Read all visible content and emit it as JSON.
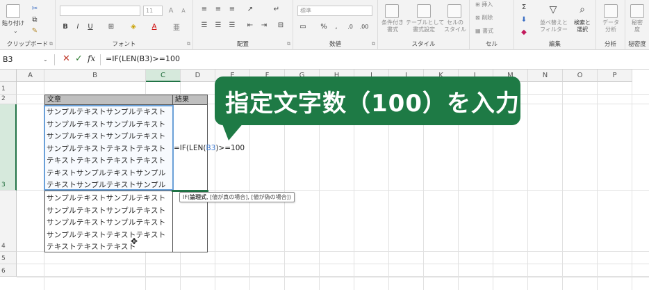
{
  "ribbon": {
    "clipboard": {
      "paste_label": "貼り付け",
      "group_label": "クリップボード"
    },
    "font": {
      "font_size": "11",
      "group_label": "フォント"
    },
    "alignment": {
      "group_label": "配置"
    },
    "number": {
      "format": "標準",
      "group_label": "数値"
    },
    "styles": {
      "conditional_label": "条件付き\n書式",
      "table_label": "テーブルとして\n書式設定",
      "cell_style_label": "セルの\nスタイル",
      "group_label": "スタイル"
    },
    "cells": {
      "insert_label": "挿入",
      "delete_label": "削除",
      "format_label": "書式",
      "group_label": "セル"
    },
    "editing": {
      "sort_label": "並べ替えと\nフィルター",
      "find_label": "検索と\n選択",
      "group_label": "編集"
    },
    "analysis": {
      "data_analysis_label": "データ\n分析",
      "group_label": "分析"
    },
    "sensitivity": {
      "label": "秘密\n度",
      "group_label": "秘密度"
    }
  },
  "formula_bar": {
    "name_box": "B3",
    "fx": "fx",
    "formula": "=IF(LEN(B3)>=100"
  },
  "columns": [
    "A",
    "B",
    "C",
    "D",
    "E",
    "F",
    "G",
    "H",
    "I",
    "J",
    "K",
    "L",
    "M",
    "N",
    "O",
    "P"
  ],
  "selected_column": "C",
  "rows": [
    "1",
    "2",
    "3",
    "4",
    "5",
    "6"
  ],
  "selected_row": "3",
  "table": {
    "header_text": "文章",
    "header_result": "結果",
    "b3_lines": [
      "サンプルテキストサンプルテキスト",
      "サンプルテキストサンプルテキスト",
      "サンプルテキストサンプルテキスト",
      "サンプルテキストテキストテキスト",
      "テキストテキストテキストテキスト",
      "テキストサンプルテキストサンプル",
      "テキストサンプルテキストサンプル"
    ],
    "b4_lines": [
      "サンプルテキストサンプルテキスト",
      "サンプルテキストサンプルテキスト",
      "サンプルテキストサンプルテキスト",
      "サンプルテキストテキストテキスト",
      "テキストテキストテキスト"
    ],
    "c3_prefix": "=IF(LEN(",
    "c3_ref": "B3",
    "c3_suffix": ")>=100"
  },
  "tooltip": {
    "func": "IF(",
    "bold_arg": "論理式",
    "rest": ", [値が真の場合], [値が偽の場合])"
  },
  "callout": {
    "text": "指定文字数（100）を入力"
  },
  "colors": {
    "excel_green": "#217346",
    "callout_bg": "#1e7a45",
    "ref_blue": "#3f7ad0"
  }
}
